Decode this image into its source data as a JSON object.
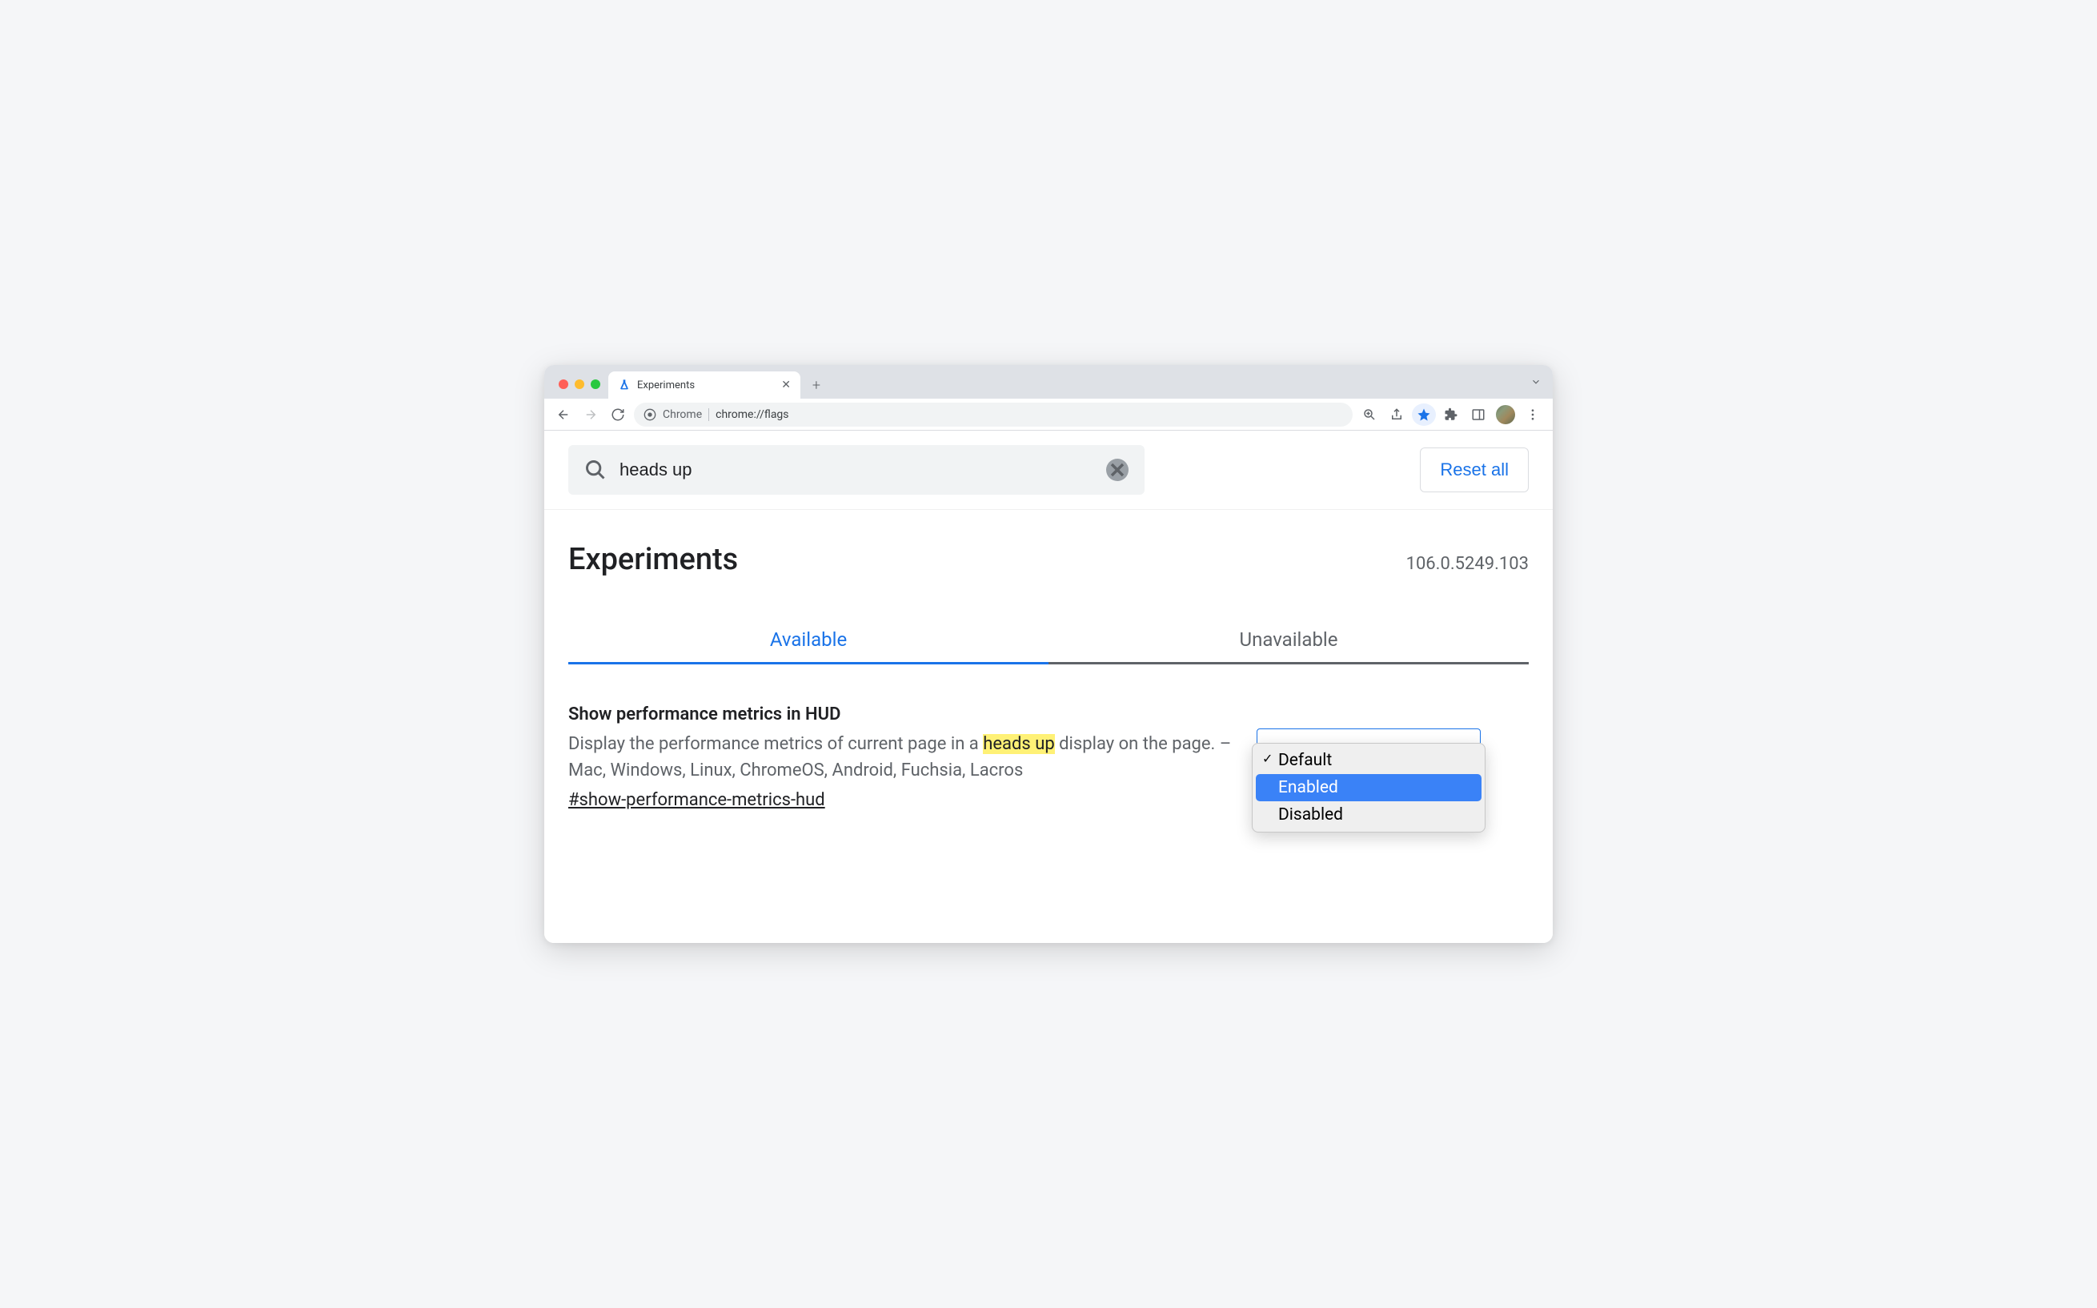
{
  "browser": {
    "tab_title": "Experiments",
    "omnibox_prefix": "Chrome",
    "omnibox_url": "chrome://flags"
  },
  "search": {
    "value": "heads up",
    "reset_label": "Reset all"
  },
  "header": {
    "title": "Experiments",
    "version": "106.0.5249.103"
  },
  "tabs": {
    "available": "Available",
    "unavailable": "Unavailable"
  },
  "flag": {
    "title": "Show performance metrics in HUD",
    "desc_before": "Display the performance metrics of current page in a ",
    "desc_highlight": "heads up",
    "desc_after": " display on the page. – Mac, Windows, Linux, ChromeOS, Android, Fuchsia, Lacros",
    "anchor": "#show-performance-metrics-hud"
  },
  "dropdown": {
    "options": {
      "default": "Default",
      "enabled": "Enabled",
      "disabled": "Disabled"
    }
  }
}
